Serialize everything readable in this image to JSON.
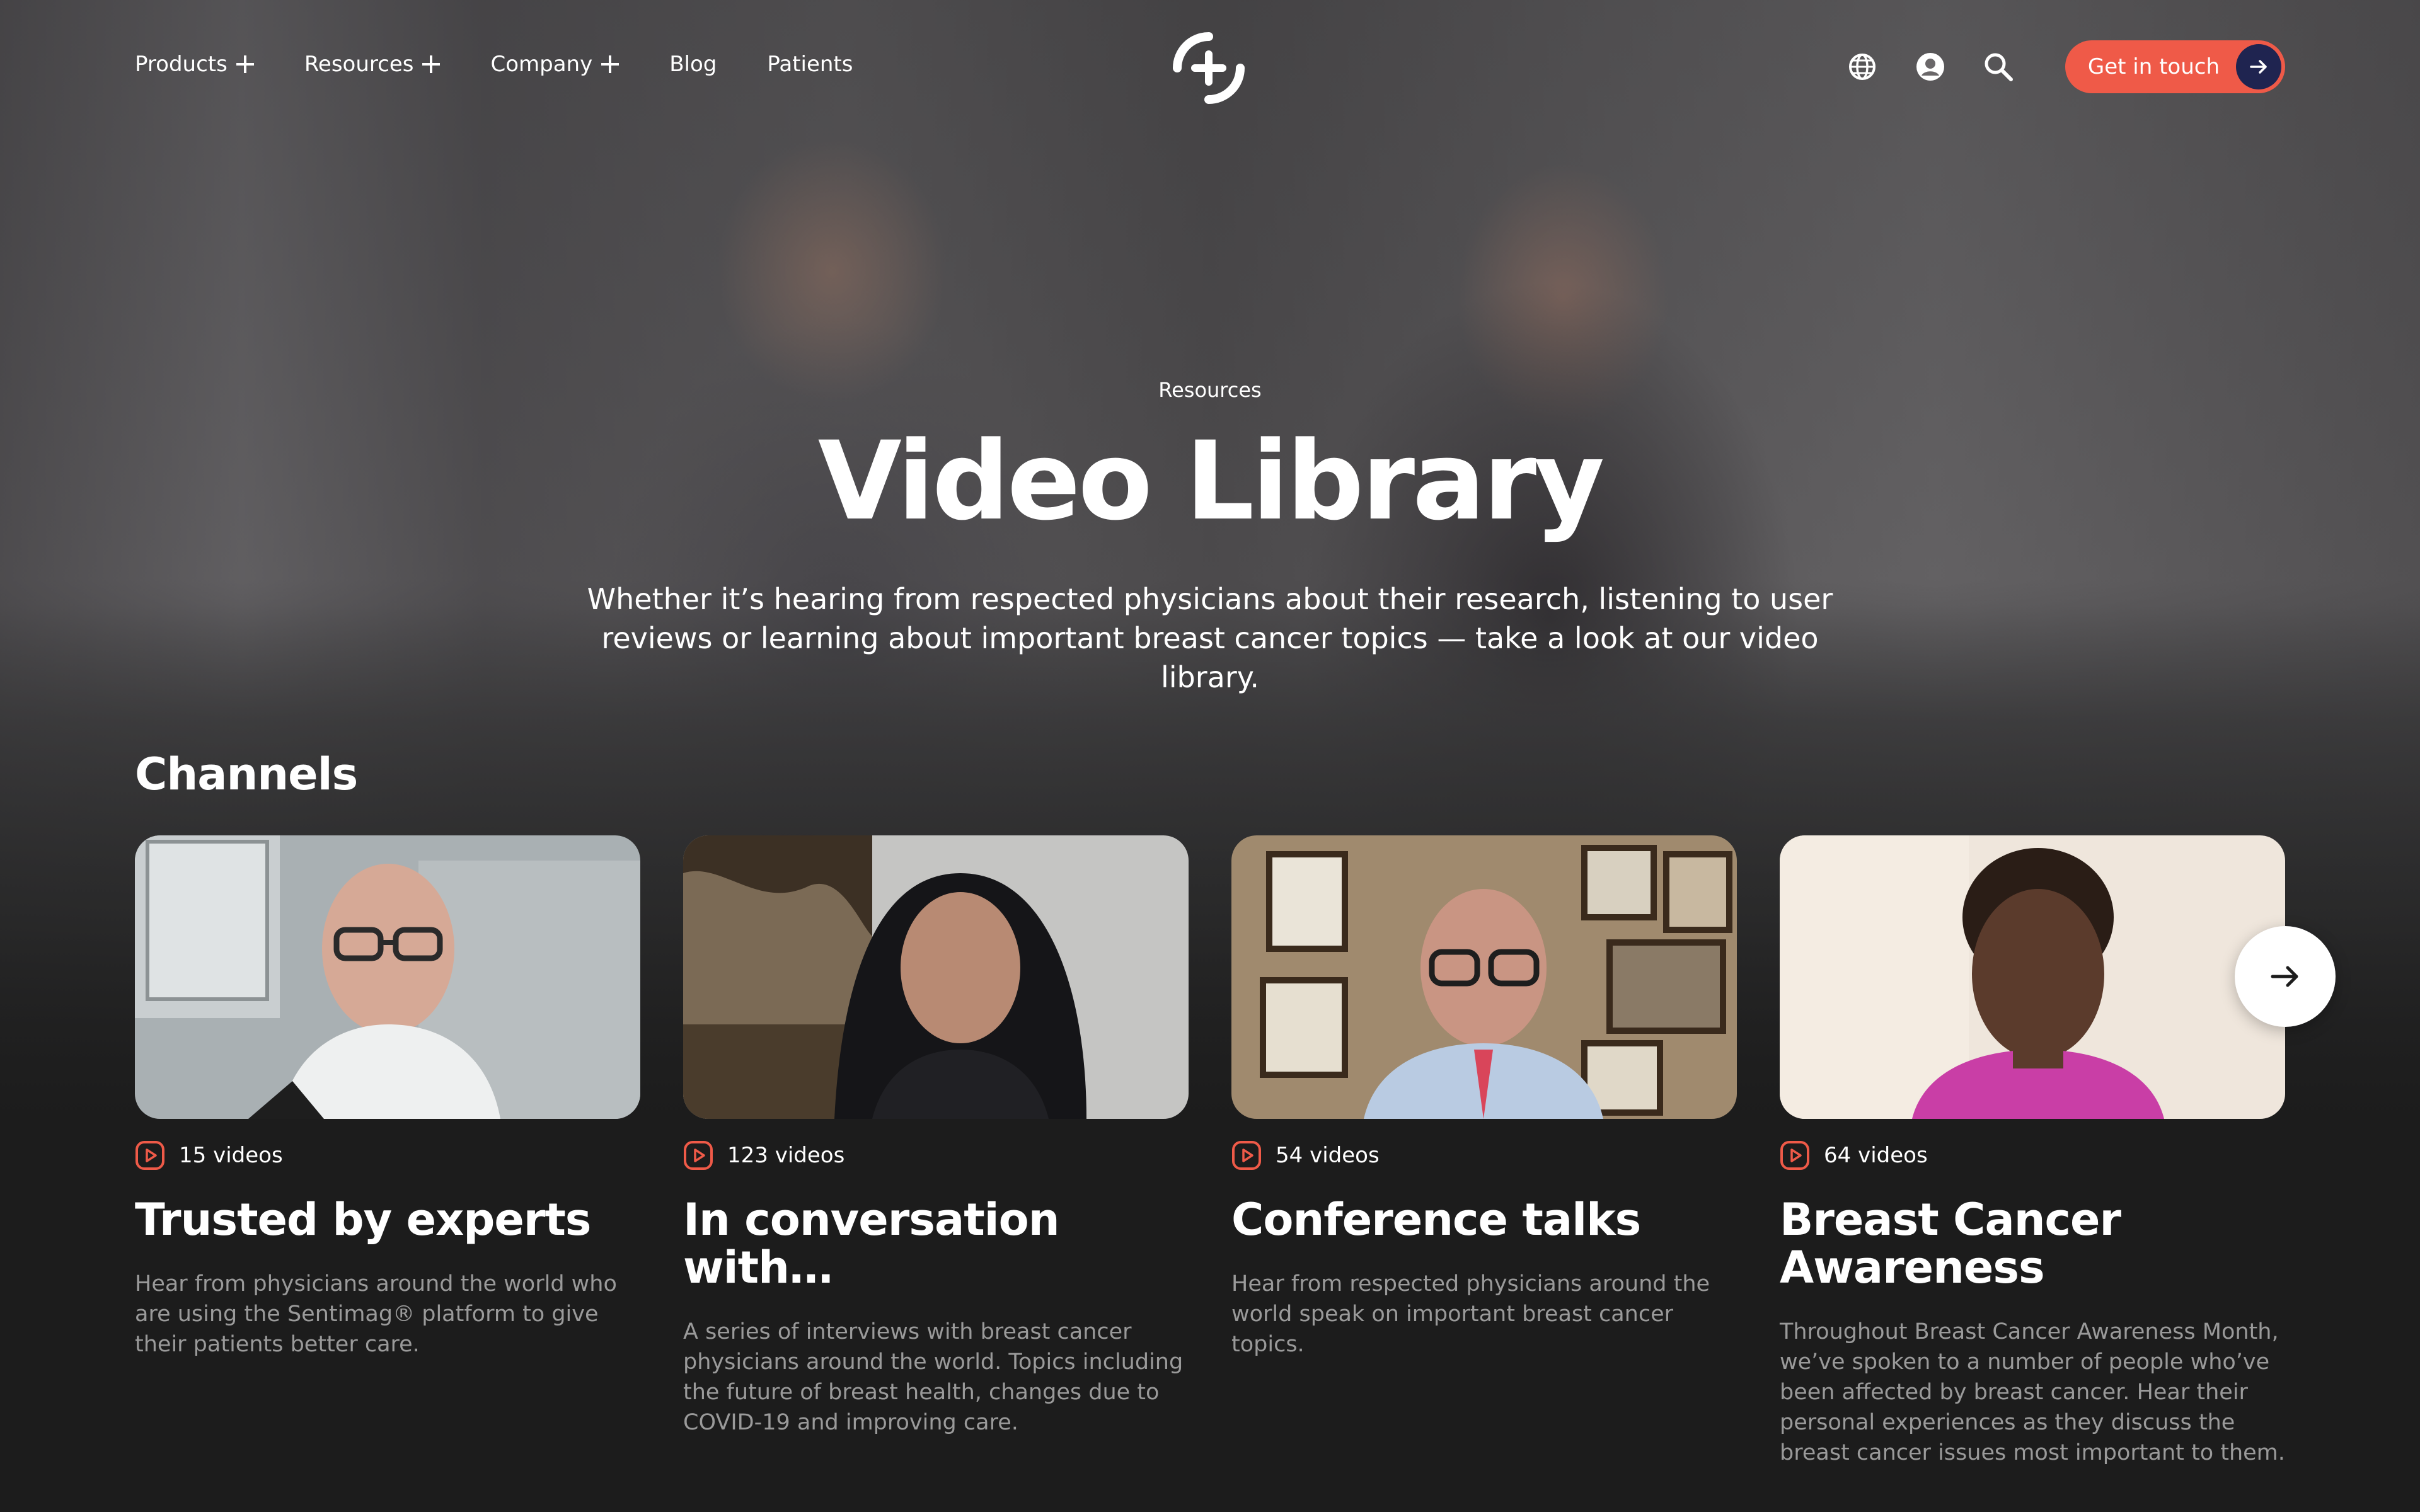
{
  "nav": {
    "items": [
      {
        "label": "Products",
        "has_submenu": true
      },
      {
        "label": "Resources",
        "has_submenu": true
      },
      {
        "label": "Company",
        "has_submenu": true
      },
      {
        "label": "Blog",
        "has_submenu": false
      },
      {
        "label": "Patients",
        "has_submenu": false
      }
    ],
    "icons": [
      "globe-icon",
      "account-icon",
      "search-icon"
    ],
    "cta_label": "Get in touch"
  },
  "hero": {
    "eyebrow": "Resources",
    "title": "Video Library",
    "description": "Whether it’s hearing from respected physicians about their research, listening to user reviews or learning about important breast cancer topics — take a look at our video library."
  },
  "channels": {
    "heading": "Channels",
    "cards": [
      {
        "count": "15 videos",
        "title": "Trusted by experts",
        "description": "Hear from physicians around the world who are using the Sentimag® platform to give their patients better care."
      },
      {
        "count": "123 videos",
        "title": "In conversation with…",
        "description": "A series of interviews with breast cancer physicians around the world. Topics including the future of breast health, changes due to COVID-19 and improving care."
      },
      {
        "count": "54 videos",
        "title": "Conference talks",
        "description": "Hear from respected physicians around the world speak on important breast cancer topics."
      },
      {
        "count": "64 videos",
        "title": "Breast Cancer Awareness",
        "description": "Throughout Breast Cancer Awareness Month, we’ve spoken to a number of people who’ve been affected by breast cancer. Hear their personal experiences as they discuss the breast cancer issues most important to them."
      }
    ]
  },
  "colors": {
    "accent": "#ef5a48",
    "cta_arrow_bg": "#1f2450",
    "page_bg": "#1c1c1c",
    "muted_text": "#9a9a9a"
  }
}
